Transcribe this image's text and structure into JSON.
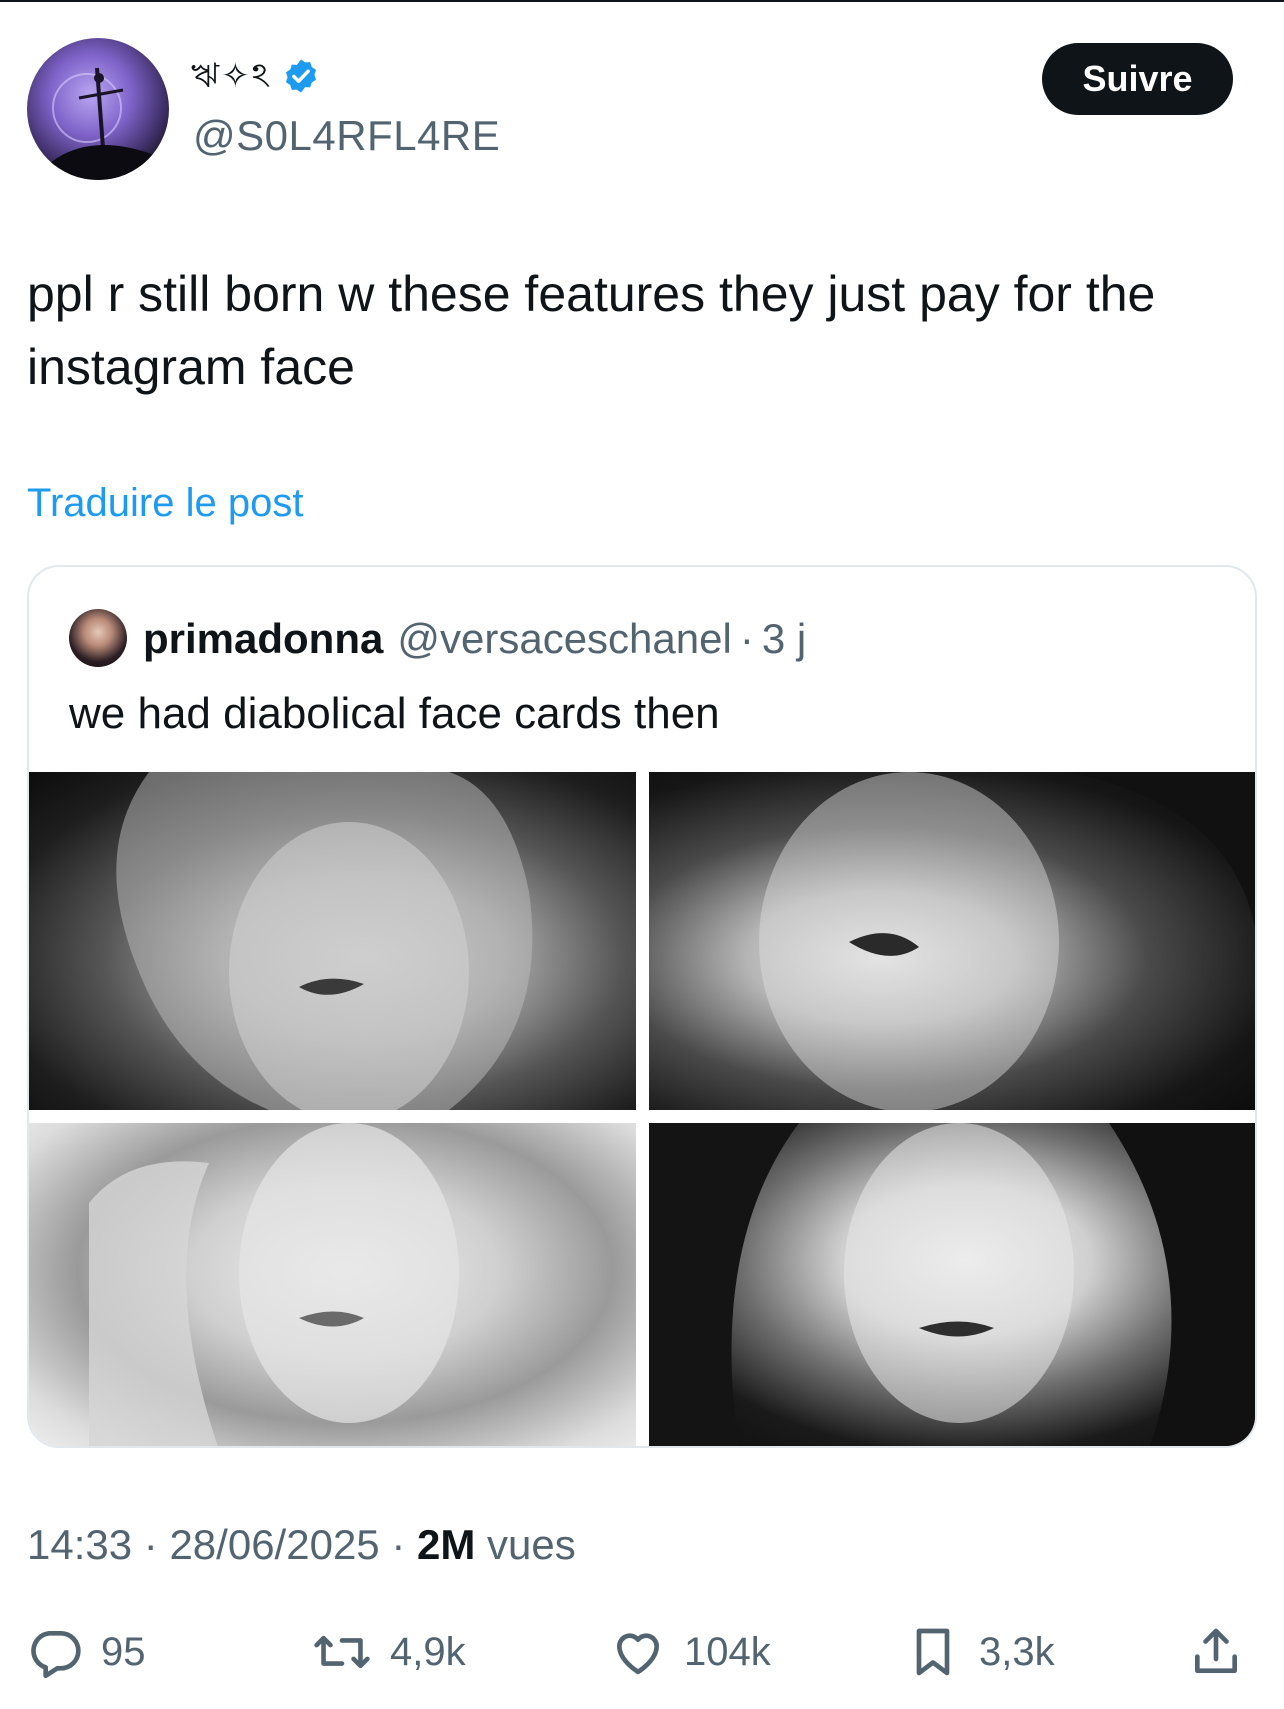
{
  "author": {
    "display_name": "ঋ✧ঽ",
    "handle": "@S0L4RFL4RE",
    "verified": true,
    "verified_color": "#1d9bf0"
  },
  "follow_label": "Suivre",
  "post": {
    "text": "ppl r still born w these features they just pay for the instagram face",
    "translate_label": "Traduire le post"
  },
  "quoted": {
    "name": "primadonna",
    "handle": "@versaceschanel",
    "separator": "·",
    "time": "3 j",
    "text": "we had diabolical face cards then",
    "photos": 4
  },
  "meta": {
    "time": "14:33",
    "date": "28/06/2025",
    "views_count": "2M",
    "views_label": "vues",
    "separator": "·"
  },
  "actions": {
    "replies": "95",
    "reposts": "4,9k",
    "likes": "104k",
    "bookmarks": "3,3k"
  },
  "icons": [
    "verified-badge-icon",
    "reply-icon",
    "repost-icon",
    "like-icon",
    "bookmark-icon",
    "share-icon"
  ]
}
